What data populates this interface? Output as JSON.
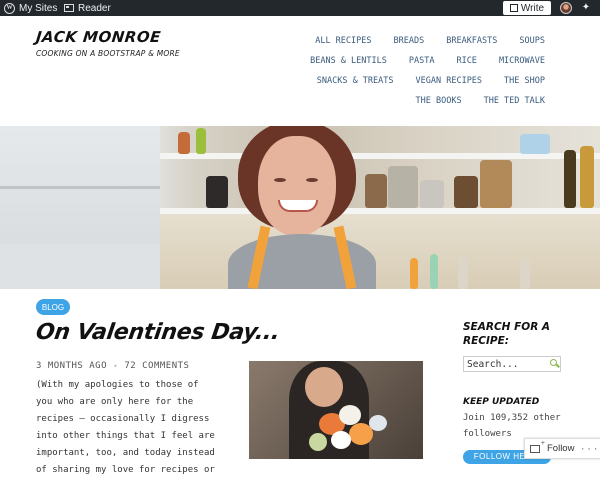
{
  "admin_bar": {
    "my_sites": "My Sites",
    "reader": "Reader",
    "write": "Write"
  },
  "site": {
    "title": "JACK MONROE",
    "tagline": "COOKING ON A BOOTSTRAP & MORE"
  },
  "nav": {
    "items": [
      {
        "label": "ALL RECIPES"
      },
      {
        "label": "BREADS"
      },
      {
        "label": "BREAKFASTS"
      },
      {
        "label": "SOUPS"
      },
      {
        "label": "BEANS & LENTILS"
      },
      {
        "label": "PASTA"
      },
      {
        "label": "RICE"
      },
      {
        "label": "MICROWAVE"
      },
      {
        "label": "SNACKS & TREATS"
      },
      {
        "label": "VEGAN RECIPES"
      },
      {
        "label": "THE SHOP"
      },
      {
        "label": "THE BOOKS"
      },
      {
        "label": "THE TED TALK"
      }
    ]
  },
  "post": {
    "category": "BLOG",
    "title": "On Valentines Day...",
    "time_ago": "3 MONTHS AGO",
    "comments": "72 COMMENTS",
    "excerpt": "(With my apologies to those of you who are only here for the recipes – occasionally I digress into other things that I feel are important, too, and today instead of sharing my love for recipes or"
  },
  "sidebar": {
    "search_title": "SEARCH FOR A RECIPE:",
    "search_placeholder": "Search...",
    "keep_updated_title": "KEEP UPDATED",
    "join_text": "Join 109,352 other followers",
    "follow_here": "FOLLOW HERE!"
  },
  "follow_widget": {
    "label": "Follow",
    "more": "···"
  },
  "colors": {
    "admin_bar": "#23282d",
    "nav_link": "#3a5b7d",
    "accent_blue": "#3fa4e6",
    "search_icon": "#8ab94a"
  }
}
